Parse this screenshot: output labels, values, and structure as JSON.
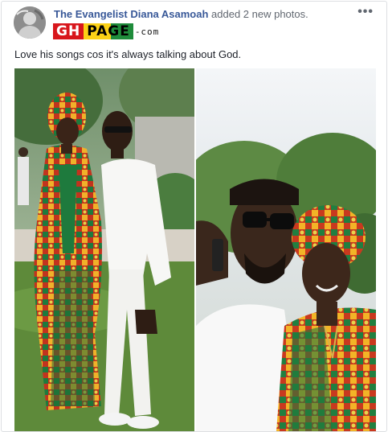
{
  "post": {
    "author": "The Evangelist Diana Asamoah",
    "action": " added 2 new photos.",
    "more_label": "•••",
    "text": "Love his songs cos it's always talking about God."
  },
  "watermark": {
    "part1": "GH",
    "part2": "PAGE",
    "part3": "-com"
  },
  "colors": {
    "author_link": "#385898",
    "watermark_red": "#d8161c",
    "watermark_yellow": "#fcd116",
    "watermark_green": "#1f8c3b"
  },
  "icons": [
    "avatar",
    "more-options-icon"
  ]
}
